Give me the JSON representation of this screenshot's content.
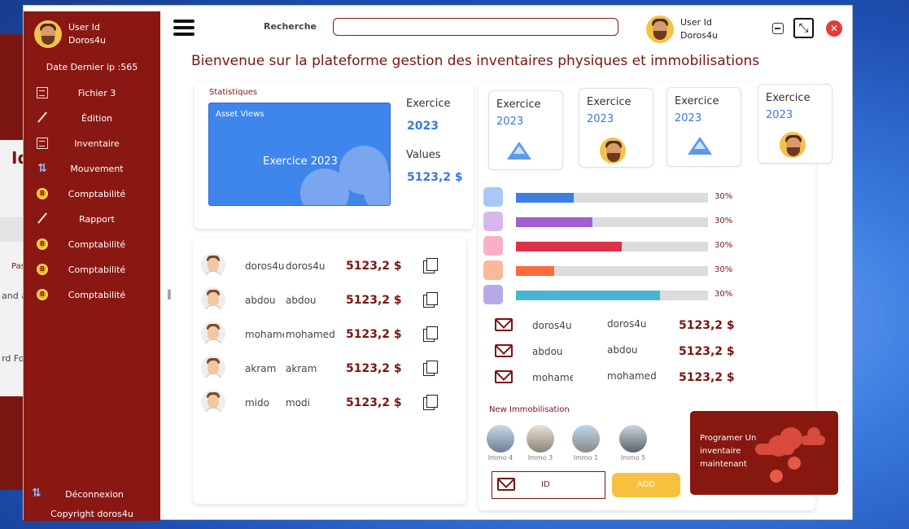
{
  "background_window": {
    "fragments": [
      "Id",
      "Pas",
      "and a",
      "rd Fo"
    ]
  },
  "sidebar": {
    "user_id_label": "User Id",
    "username": "Doros4u",
    "last_ip": "Date Dernier ip :565",
    "items": [
      {
        "label": "Fichier   3",
        "icon": "document-icon"
      },
      {
        "label": "Édition",
        "icon": "pencil-icon"
      },
      {
        "label": "Inventaire",
        "icon": "document-icon"
      },
      {
        "label": "Mouvement",
        "icon": "arrows-icon"
      },
      {
        "label": "Comptabilité",
        "icon": "coin-icon"
      },
      {
        "label": "Rapport",
        "icon": "pencil-icon"
      },
      {
        "label": "Comptabilité",
        "icon": "coin-icon"
      },
      {
        "label": "Comptabilité",
        "icon": "coin-icon"
      },
      {
        "label": "Comptabilité",
        "icon": "coin-icon"
      }
    ],
    "logout": "Déconnexion",
    "copyright": "Copyright doros4u"
  },
  "header": {
    "search_label": "Recherche",
    "search_value": "",
    "user_id_label": "User Id",
    "username": "Doros4u"
  },
  "page_title": "Bienvenue sur la plateforme gestion des inventaires  physiques et immobilisations",
  "stats": {
    "title": "Statistiques",
    "asset_views": "Asset Views",
    "asset_box_title": "Exercice 2023",
    "exercice_label": "Exercice",
    "exercice_value": "2023",
    "values_label": "Values",
    "values_value": "5123,2 $"
  },
  "users_list": [
    {
      "name1": "doros4u",
      "name2": "doros4u",
      "value": "5123,2 $"
    },
    {
      "name1": "abdou",
      "name2": "abdou",
      "value": "5123,2 $"
    },
    {
      "name1": "mohamed",
      "name2": "mohamed",
      "value": "5123,2 $"
    },
    {
      "name1": "akram",
      "name2": "akram",
      "value": "5123,2 $"
    },
    {
      "name1": "mido",
      "name2": "modi",
      "value": "5123,2 $"
    }
  ],
  "exercice_cards": [
    {
      "label": "Exercice",
      "year": "2023",
      "icon": "mountain-icon"
    },
    {
      "label": "Exercice",
      "year": "2023",
      "icon": "avatar-icon"
    },
    {
      "label": "Exercice",
      "year": "2023",
      "icon": "mountain-icon"
    },
    {
      "label": "Exercice",
      "year": "2023",
      "icon": "avatar-icon"
    }
  ],
  "progress": [
    {
      "square_color": "#a9c8f7",
      "bar_color": "#3f7fe0",
      "fill": 0.3,
      "label": "30%"
    },
    {
      "square_color": "#d8b8ec",
      "bar_color": "#a060d0",
      "fill": 0.4,
      "label": "30%"
    },
    {
      "square_color": "#f7b0c6",
      "bar_color": "#dc3248",
      "fill": 0.55,
      "label": "30%"
    },
    {
      "square_color": "#f9b89a",
      "bar_color": "#ff6a3a",
      "fill": 0.2,
      "label": "30%"
    },
    {
      "square_color": "#b7a8e6",
      "bar_color": "#48b6d0",
      "fill": 0.75,
      "label": "30%"
    }
  ],
  "mail_list": [
    {
      "name1": "doros4u",
      "name2": "doros4u",
      "value": "5123,2 $"
    },
    {
      "name1": "abdou",
      "name2": "abdou",
      "value": "5123,2 $"
    },
    {
      "name1": "mohamed",
      "name2": "mohamed",
      "value": "5123,2 $"
    }
  ],
  "new_immobilisation": {
    "title": "New Immobilisation",
    "items": [
      "Immo 4",
      "Immo 3",
      "Immo 1",
      "Immo 5"
    ],
    "id_placeholder": "ID",
    "add_label": "ADD"
  },
  "plan_card": {
    "text": "Programer Un inventaire maintenant"
  },
  "colors": {
    "primary": "#8a1812",
    "accent_blue": "#3f86ec",
    "add_button": "#f8c13d"
  }
}
